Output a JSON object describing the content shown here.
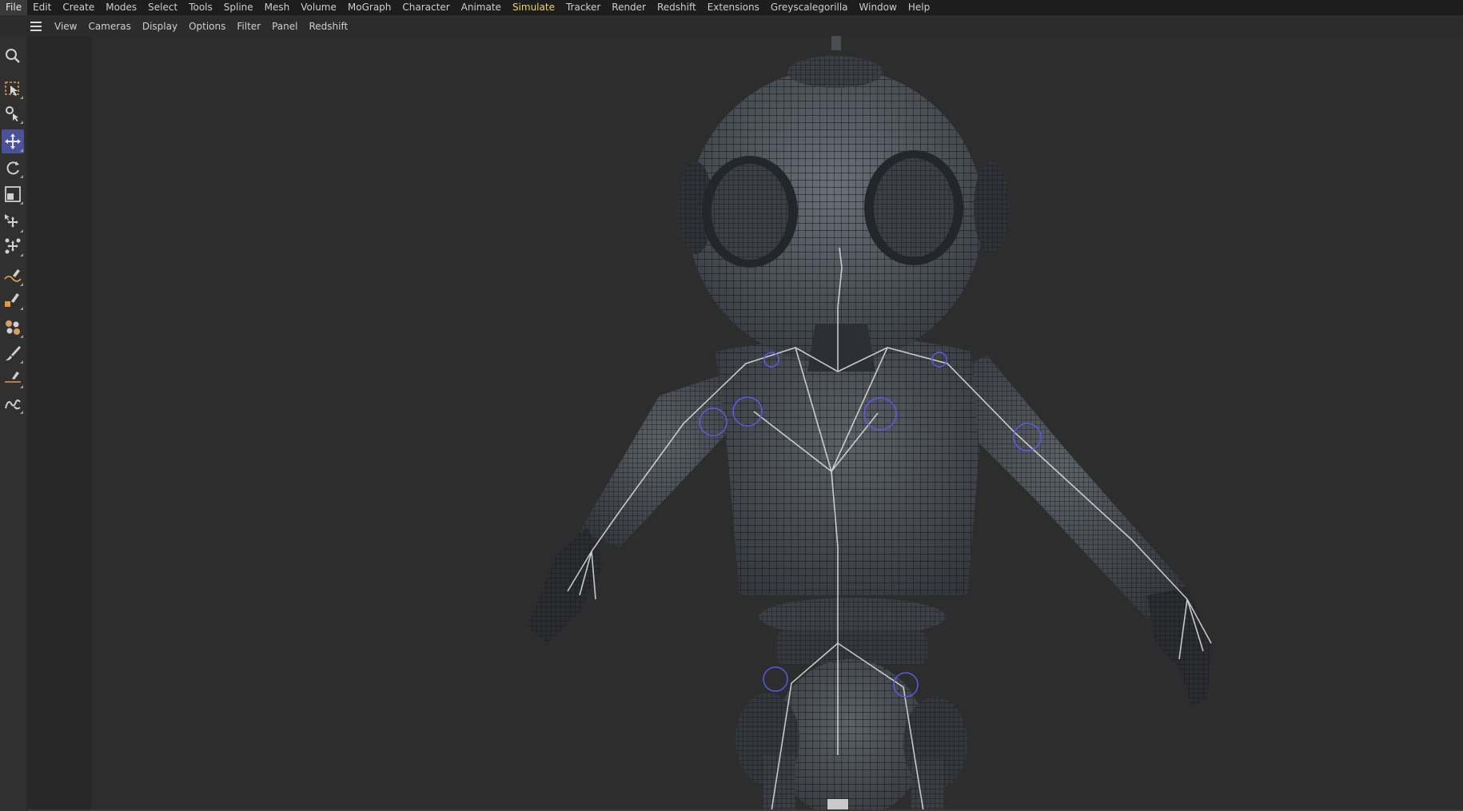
{
  "menu": {
    "items": [
      {
        "label": "File"
      },
      {
        "label": "Edit"
      },
      {
        "label": "Create"
      },
      {
        "label": "Modes"
      },
      {
        "label": "Select"
      },
      {
        "label": "Tools"
      },
      {
        "label": "Spline"
      },
      {
        "label": "Mesh"
      },
      {
        "label": "Volume"
      },
      {
        "label": "MoGraph"
      },
      {
        "label": "Character"
      },
      {
        "label": "Animate"
      },
      {
        "label": "Simulate"
      },
      {
        "label": "Tracker"
      },
      {
        "label": "Render"
      },
      {
        "label": "Redshift"
      },
      {
        "label": "Extensions"
      },
      {
        "label": "Greyscalegorilla"
      },
      {
        "label": "Window"
      },
      {
        "label": "Help"
      }
    ],
    "active": "File",
    "highlighted": "Simulate"
  },
  "viewport_menu": {
    "items": [
      "View",
      "Cameras",
      "Display",
      "Options",
      "Filter",
      "Panel",
      "Redshift"
    ]
  },
  "tools": [
    {
      "name": "search-icon"
    },
    {
      "name": "live-selection-icon"
    },
    {
      "name": "tweak-settings-icon"
    },
    {
      "name": "move-icon",
      "active": true
    },
    {
      "name": "rotate-icon"
    },
    {
      "name": "scale-icon"
    },
    {
      "name": "transform-icon"
    },
    {
      "name": "snap-transform-icon"
    },
    {
      "name": "spline-pen-icon"
    },
    {
      "name": "spline-primitive-icon"
    },
    {
      "name": "paint-weights-icon"
    },
    {
      "name": "brush-icon"
    },
    {
      "name": "knife-icon"
    },
    {
      "name": "sketch-icon"
    }
  ],
  "colors": {
    "menubar_bg": "#1d1d1d",
    "viewport_bg": "#2d2d2d",
    "active_tool": "#4b5297",
    "highlight_menu": "#f0d264",
    "joint_ring": "#5a5ae8"
  }
}
